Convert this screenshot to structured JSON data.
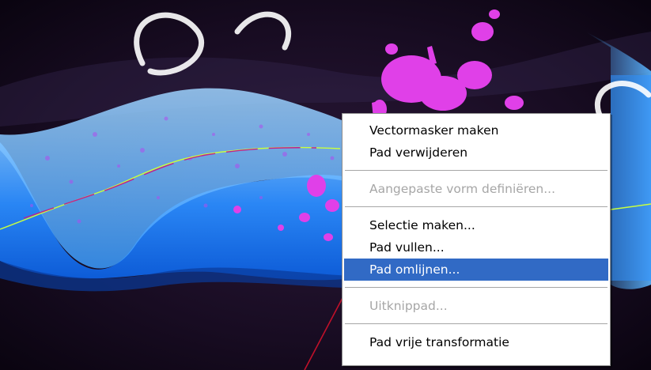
{
  "context_menu": {
    "items": [
      {
        "label": "Vectormasker maken",
        "enabled": true
      },
      {
        "label": "Pad verwijderen",
        "enabled": true
      },
      {
        "label": "Aangepaste vorm definiëren...",
        "enabled": false
      },
      {
        "label": "Selectie maken...",
        "enabled": true
      },
      {
        "label": "Pad vullen...",
        "enabled": true
      },
      {
        "label": "Pad omlijnen...",
        "enabled": true,
        "highlighted": true
      },
      {
        "label": "Uitknippad...",
        "enabled": false
      },
      {
        "label": "Pad vrije transformatie",
        "enabled": true
      }
    ]
  },
  "colors": {
    "background_dark": "#1a0d22",
    "wave_blue": "#1e8cff",
    "wave_light": "#7fc8ff",
    "splatter_pink": "#e040e8",
    "path_green": "#c8ff40",
    "path_magenta": "#c0208c",
    "highlight": "#316ac5",
    "disabled_text": "#a6a6a6",
    "arrow_red": "#c0102a"
  }
}
